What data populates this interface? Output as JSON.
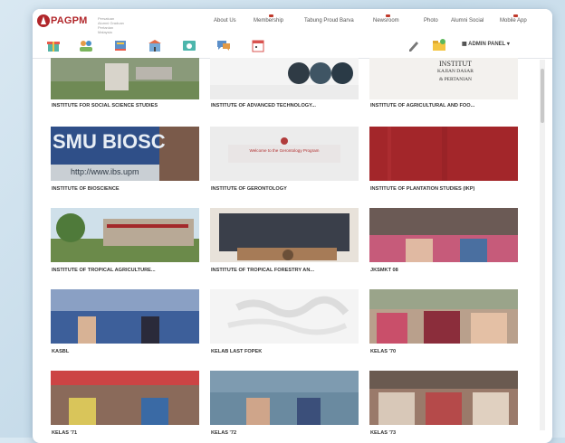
{
  "header": {
    "logo": "PAGPM",
    "logo_sub": "Persatuan Alumni Graduan Pertanian Malaysia",
    "nav": [
      "About Us",
      "Membership",
      "Tabung Proud Barva",
      "Newsroom",
      "Photo",
      "Alumni Social",
      "Mobile App"
    ]
  },
  "toolbar": {
    "icons": [
      "gift-icon",
      "people-icon",
      "book-icon",
      "building-icon",
      "photo-icon",
      "chat-icon",
      "calendar-icon"
    ],
    "right_icons": [
      "edit-icon",
      "folder-icon"
    ],
    "admin_label": "ADMIN PANEL"
  },
  "gallery": [
    {
      "caption": "INSTITUTE FOR SOCIAL SCIENCE STUDIES",
      "kind": "outdoor"
    },
    {
      "caption": "INSTITUTE OF ADVANCED TECHNOLOGY...",
      "kind": "tech"
    },
    {
      "caption": "INSTITUTE OF AGRICULTURAL AND FOO...",
      "kind": "text-logo"
    },
    {
      "caption": "INSTITUTE OF BIOSCIENCE",
      "kind": "sign"
    },
    {
      "caption": "INSTITUTE OF GERONTOLOGY",
      "kind": "banner"
    },
    {
      "caption": "INSTITUTE OF PLANTATION STUDIES (IKP)",
      "kind": "red"
    },
    {
      "caption": "INSTITUTE OF TROPICAL AGRICULTURE...",
      "kind": "building"
    },
    {
      "caption": "INSTITUTE OF TROPICAL FORESTRY AN...",
      "kind": "group-formal"
    },
    {
      "caption": "JKSMKT 08",
      "kind": "group"
    },
    {
      "caption": "KASBL",
      "kind": "group"
    },
    {
      "caption": "KELAB LAST FOPEK",
      "kind": "map"
    },
    {
      "caption": "KELAS '70",
      "kind": "group"
    },
    {
      "caption": "KELAS '71",
      "kind": "group"
    },
    {
      "caption": "KELAS '72",
      "kind": "group"
    },
    {
      "caption": "KELAS '73",
      "kind": "group"
    }
  ],
  "thumb_text": {
    "sign": "SMU BIOSC",
    "sign_url": "http://www.ibs.upm",
    "text_logo": [
      "INSTITUT",
      "KAJIAN DASAR",
      "& PERTANIAN"
    ],
    "banner": "Welcome to the Gerontology Program"
  }
}
